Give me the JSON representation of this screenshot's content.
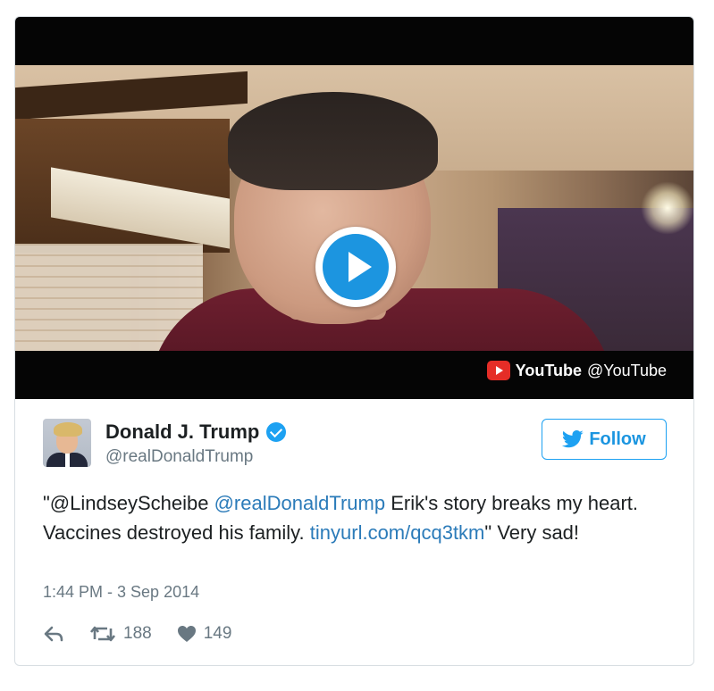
{
  "media": {
    "provider_name": "YouTube",
    "provider_handle": "@YouTube",
    "play_icon": "play-icon",
    "provider_icon": "youtube-icon"
  },
  "author": {
    "display_name": "Donald J. Trump",
    "handle": "@realDonaldTrump",
    "verified": true,
    "verified_icon": "verified-badge-icon"
  },
  "follow_button": {
    "label": "Follow",
    "icon": "twitter-bird-icon",
    "color": "#1da1f2"
  },
  "tweet": {
    "text_parts": [
      {
        "text": "\"@LindseyScheibe ",
        "type": "plain"
      },
      {
        "text": "@realDonaldTrump",
        "type": "link"
      },
      {
        "text": " Erik's story breaks my heart. Vaccines destroyed his family. ",
        "type": "plain"
      },
      {
        "text": "tinyurl.com/qcq3tkm",
        "type": "link"
      },
      {
        "text": "\" Very sad!",
        "type": "plain"
      }
    ],
    "link_color": "#2b7bb9",
    "timestamp": "1:44 PM - 3 Sep 2014"
  },
  "actions": {
    "reply_icon": "reply-icon",
    "retweet_icon": "retweet-icon",
    "retweet_count": "188",
    "like_icon": "heart-icon",
    "like_count": "149"
  }
}
